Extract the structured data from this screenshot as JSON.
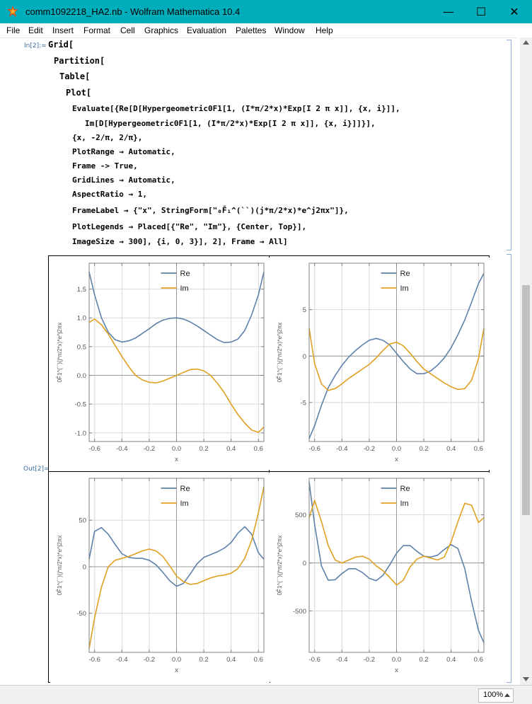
{
  "window": {
    "title": "comm1092218_HA2.nb - Wolfram Mathematica 10.4",
    "minimize": "—",
    "maximize": "☐",
    "close": "✕"
  },
  "menu": [
    "File",
    "Edit",
    "Insert",
    "Format",
    "Cell",
    "Graphics",
    "Evaluation",
    "Palettes",
    "Window",
    "Help"
  ],
  "notebook": {
    "in_label": "In[2]:=",
    "out_label": "Out[2]=",
    "code_lines": [
      "Grid[",
      "Partition[",
      "Table[",
      "Plot[",
      "Evaluate[{Re[D[Hypergeometric0F1[1, (I*π/2*x)*Exp[I 2 π x]], {x, i}]],",
      "Im[D[Hypergeometric0F1[1, (I*π/2*x)*Exp[I 2 π x]], {x, i}]]}],",
      "{x, -2/π, 2/π},",
      "PlotRange → Automatic,",
      "Frame -> True,",
      "GridLines → Automatic,",
      "AspectRatio → 1,",
      "FrameLabel → {\"x\", StringForm[\"₀F̃₁^(``)(j*π/2*x)*e^j2πx\"]},",
      "PlotLegends → Placed[{\"Re\", \"Im\"}, {Center, Top}],",
      "ImageSize → 300], {i, 0, 3}], 2], Frame → All]"
    ]
  },
  "status": {
    "zoom": "100%"
  },
  "colors": {
    "re": "#5e81ac",
    "im": "#e0a020",
    "titlebar": "#00aebb"
  },
  "chart_data": [
    {
      "type": "line",
      "xlabel": "x",
      "ylabel": "0F̃1^(``)(j*π/2*x)*e^j2πx",
      "xlim": [
        -0.64,
        0.64
      ],
      "ylim": [
        -1.15,
        1.95
      ],
      "xticks": [
        -0.6,
        -0.4,
        -0.2,
        0.0,
        0.2,
        0.4,
        0.6
      ],
      "yticks": [
        -1.0,
        -0.5,
        0.0,
        0.5,
        1.0,
        1.5
      ],
      "ytick_labels": [
        "-1.0",
        "-0.5",
        "0.0",
        "0.5",
        "1.0",
        "1.5"
      ],
      "legend": [
        "Re",
        "Im"
      ],
      "series": [
        {
          "name": "Re",
          "x": [
            -0.64,
            -0.6,
            -0.55,
            -0.5,
            -0.45,
            -0.4,
            -0.35,
            -0.3,
            -0.25,
            -0.2,
            -0.15,
            -0.1,
            -0.05,
            0,
            0.05,
            0.1,
            0.15,
            0.2,
            0.25,
            0.3,
            0.35,
            0.4,
            0.45,
            0.5,
            0.55,
            0.6,
            0.64
          ],
          "y": [
            1.8,
            1.4,
            1.0,
            0.75,
            0.62,
            0.58,
            0.6,
            0.65,
            0.73,
            0.81,
            0.9,
            0.96,
            0.99,
            1.0,
            0.98,
            0.93,
            0.86,
            0.78,
            0.7,
            0.62,
            0.57,
            0.58,
            0.63,
            0.78,
            1.05,
            1.4,
            1.8
          ]
        },
        {
          "name": "Im",
          "x": [
            -0.64,
            -0.6,
            -0.55,
            -0.5,
            -0.45,
            -0.4,
            -0.35,
            -0.3,
            -0.25,
            -0.2,
            -0.15,
            -0.1,
            -0.05,
            0,
            0.05,
            0.1,
            0.15,
            0.2,
            0.25,
            0.3,
            0.35,
            0.4,
            0.45,
            0.5,
            0.55,
            0.6,
            0.64
          ],
          "y": [
            0.92,
            0.98,
            0.88,
            0.72,
            0.52,
            0.33,
            0.15,
            -0.0,
            -0.08,
            -0.12,
            -0.13,
            -0.1,
            -0.05,
            0.0,
            0.05,
            0.1,
            0.11,
            0.08,
            0.0,
            -0.14,
            -0.3,
            -0.5,
            -0.68,
            -0.83,
            -0.95,
            -0.99,
            -0.9
          ]
        }
      ]
    },
    {
      "type": "line",
      "xlabel": "x",
      "ylabel": "0F̃1^(``)(j*π/2*x)*e^j2πx",
      "xlim": [
        -0.64,
        0.64
      ],
      "ylim": [
        -9.2,
        10.0
      ],
      "xticks": [
        -0.6,
        -0.4,
        -0.2,
        0.0,
        0.2,
        0.4,
        0.6
      ],
      "yticks": [
        -5,
        0,
        5
      ],
      "ytick_labels": [
        "-5",
        "0",
        "5"
      ],
      "legend": [
        "Re",
        "Im"
      ],
      "series": [
        {
          "name": "Re",
          "x": [
            -0.64,
            -0.6,
            -0.55,
            -0.5,
            -0.45,
            -0.4,
            -0.35,
            -0.3,
            -0.25,
            -0.2,
            -0.15,
            -0.1,
            -0.05,
            0,
            0.05,
            0.1,
            0.15,
            0.2,
            0.25,
            0.3,
            0.35,
            0.4,
            0.45,
            0.5,
            0.55,
            0.6,
            0.64
          ],
          "y": [
            -8.9,
            -7.5,
            -5.3,
            -3.4,
            -2.1,
            -1.0,
            -0.1,
            0.6,
            1.2,
            1.7,
            1.9,
            1.7,
            1.2,
            0.3,
            -0.6,
            -1.4,
            -1.9,
            -1.9,
            -1.6,
            -1.0,
            -0.2,
            0.9,
            2.3,
            3.9,
            5.8,
            7.8,
            8.9
          ]
        },
        {
          "name": "Im",
          "x": [
            -0.64,
            -0.6,
            -0.55,
            -0.5,
            -0.45,
            -0.4,
            -0.35,
            -0.3,
            -0.25,
            -0.2,
            -0.15,
            -0.1,
            -0.05,
            0,
            0.05,
            0.1,
            0.15,
            0.2,
            0.25,
            0.3,
            0.35,
            0.4,
            0.45,
            0.5,
            0.55,
            0.6,
            0.64
          ],
          "y": [
            3.0,
            -0.8,
            -3.0,
            -3.7,
            -3.5,
            -3.0,
            -2.4,
            -1.9,
            -1.4,
            -0.9,
            -0.2,
            0.6,
            1.3,
            1.5,
            1.1,
            0.3,
            -0.6,
            -1.4,
            -1.9,
            -2.4,
            -2.9,
            -3.3,
            -3.6,
            -3.5,
            -2.6,
            -0.3,
            3.0
          ]
        }
      ]
    },
    {
      "type": "line",
      "xlabel": "x",
      "ylabel": "0F̃1^(``)(j*π/2*x)*e^j2πx",
      "xlim": [
        -0.64,
        0.64
      ],
      "ylim": [
        -92,
        95
      ],
      "xticks": [
        -0.6,
        -0.4,
        -0.2,
        0.0,
        0.2,
        0.4,
        0.6
      ],
      "yticks": [
        -50,
        0,
        50
      ],
      "ytick_labels": [
        "-50",
        "0",
        "50"
      ],
      "legend": [
        "Re",
        "Im"
      ],
      "series": [
        {
          "name": "Re",
          "x": [
            -0.64,
            -0.6,
            -0.55,
            -0.5,
            -0.45,
            -0.4,
            -0.35,
            -0.3,
            -0.25,
            -0.2,
            -0.15,
            -0.1,
            -0.05,
            0,
            0.05,
            0.1,
            0.15,
            0.2,
            0.25,
            0.3,
            0.35,
            0.4,
            0.45,
            0.5,
            0.55,
            0.6,
            0.64
          ],
          "y": [
            8,
            38,
            42,
            35,
            24,
            14,
            10,
            9,
            9,
            7,
            2,
            -6,
            -15,
            -21,
            -18,
            -8,
            3,
            10,
            13,
            16,
            20,
            26,
            36,
            43,
            35,
            15,
            8
          ]
        },
        {
          "name": "Im",
          "x": [
            -0.64,
            -0.6,
            -0.55,
            -0.5,
            -0.45,
            -0.4,
            -0.35,
            -0.3,
            -0.25,
            -0.2,
            -0.15,
            -0.1,
            -0.05,
            0,
            0.05,
            0.1,
            0.15,
            0.2,
            0.25,
            0.3,
            0.35,
            0.4,
            0.45,
            0.5,
            0.55,
            0.6,
            0.64
          ],
          "y": [
            -88,
            -55,
            -22,
            0,
            7,
            9,
            11,
            14,
            17,
            19,
            17,
            11,
            1,
            -10,
            -16,
            -19,
            -18,
            -15,
            -12,
            -10,
            -9,
            -7,
            -2,
            9,
            28,
            58,
            86
          ]
        }
      ]
    },
    {
      "type": "line",
      "xlabel": "x",
      "ylabel": "0F̃1^(``)(j*π/2*x)*e^j2πx",
      "xlim": [
        -0.64,
        0.64
      ],
      "ylim": [
        -930,
        880
      ],
      "xticks": [
        -0.6,
        -0.4,
        -0.2,
        0.0,
        0.2,
        0.4,
        0.6
      ],
      "yticks": [
        -500,
        0,
        500
      ],
      "ytick_labels": [
        "-500",
        "0",
        "500"
      ],
      "legend": [
        "Re",
        "Im"
      ],
      "series": [
        {
          "name": "Re",
          "x": [
            -0.64,
            -0.6,
            -0.55,
            -0.5,
            -0.45,
            -0.4,
            -0.35,
            -0.3,
            -0.25,
            -0.2,
            -0.15,
            -0.1,
            -0.05,
            0,
            0.05,
            0.1,
            0.15,
            0.2,
            0.25,
            0.3,
            0.35,
            0.4,
            0.45,
            0.5,
            0.55,
            0.6,
            0.64
          ],
          "y": [
            840,
            400,
            -30,
            -180,
            -175,
            -110,
            -60,
            -60,
            -100,
            -160,
            -185,
            -130,
            -20,
            100,
            180,
            180,
            120,
            70,
            60,
            80,
            140,
            190,
            150,
            -60,
            -400,
            -700,
            -830
          ]
        },
        {
          "name": "Im",
          "x": [
            -0.64,
            -0.6,
            -0.55,
            -0.5,
            -0.45,
            -0.4,
            -0.35,
            -0.3,
            -0.25,
            -0.2,
            -0.15,
            -0.1,
            -0.05,
            0,
            0.05,
            0.1,
            0.15,
            0.2,
            0.25,
            0.3,
            0.35,
            0.4,
            0.45,
            0.5,
            0.55,
            0.6,
            0.64
          ],
          "y": [
            470,
            650,
            430,
            180,
            30,
            0,
            30,
            60,
            70,
            40,
            -30,
            -80,
            -150,
            -230,
            -180,
            -40,
            40,
            70,
            50,
            30,
            60,
            220,
            430,
            620,
            600,
            420,
            470
          ]
        }
      ]
    }
  ]
}
